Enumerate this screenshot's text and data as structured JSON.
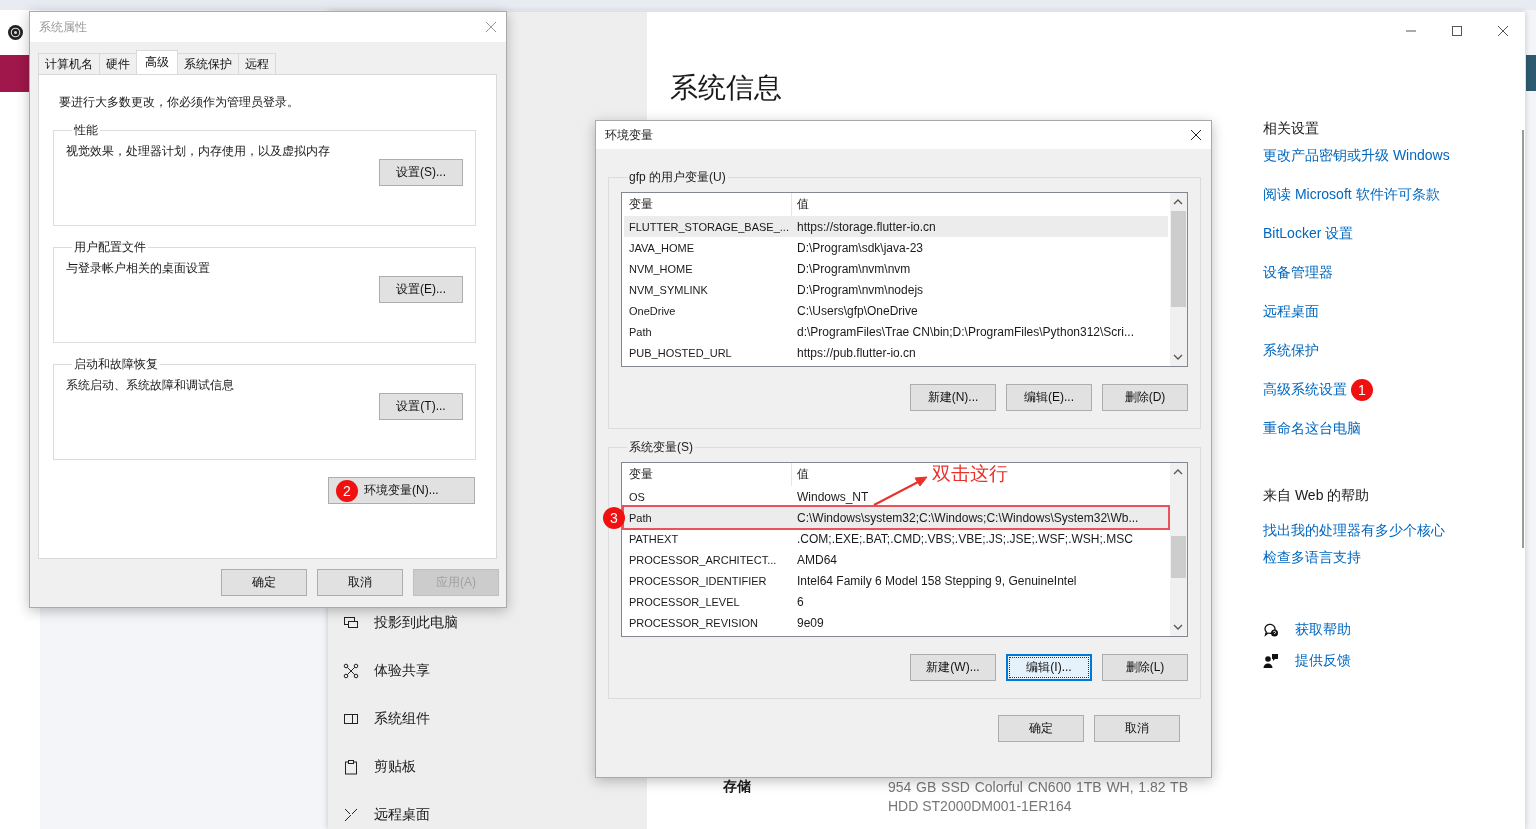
{
  "settings_window": {
    "heading": "系统信息",
    "nav_items": [
      {
        "label": "投影到此电脑"
      },
      {
        "label": "体验共享"
      },
      {
        "label": "系统组件"
      },
      {
        "label": "剪贴板"
      },
      {
        "label": "远程桌面"
      }
    ],
    "storage": {
      "label": "存储",
      "value": "954 GB SSD Colorful CN600 1TB WH, 1.82 TB HDD ST2000DM001-1ER164"
    },
    "related": {
      "title": "相关设置",
      "links": [
        {
          "label": "更改产品密钥或升级 Windows"
        },
        {
          "label": "阅读 Microsoft 软件许可条款"
        },
        {
          "label": "BitLocker 设置"
        },
        {
          "label": "设备管理器"
        },
        {
          "label": "远程桌面"
        },
        {
          "label": "系统保护"
        },
        {
          "label": "高级系统设置",
          "badge": "1"
        },
        {
          "label": "重命名这台电脑"
        }
      ]
    },
    "web_help": {
      "title": "来自 Web 的帮助",
      "links": [
        {
          "label": "找出我的处理器有多少个核心"
        },
        {
          "label": "检查多语言支持"
        }
      ]
    },
    "support_links": [
      {
        "label": "获取帮助"
      },
      {
        "label": "提供反馈"
      }
    ]
  },
  "system_properties": {
    "title": "系统属性",
    "active": false,
    "tabs": [
      {
        "label": "计算机名",
        "selected": false
      },
      {
        "label": "硬件",
        "selected": false
      },
      {
        "label": "高级",
        "selected": true
      },
      {
        "label": "系统保护",
        "selected": false
      },
      {
        "label": "远程",
        "selected": false
      }
    ],
    "notice": "要进行大多数更改，你必须作为管理员登录。",
    "groups": [
      {
        "title": "性能",
        "description": "视觉效果，处理器计划，内存使用，以及虚拟内存",
        "button": "设置(S)..."
      },
      {
        "title": "用户配置文件",
        "description": "与登录帐户相关的桌面设置",
        "button": "设置(E)..."
      },
      {
        "title": "启动和故障恢复",
        "description": "系统启动、系统故障和调试信息",
        "button": "设置(T)..."
      }
    ],
    "env_button": {
      "label": "环境变量(N)...",
      "badge": "2"
    },
    "footer_buttons": [
      {
        "label": "确定",
        "disabled": false
      },
      {
        "label": "取消",
        "disabled": false
      },
      {
        "label": "应用(A)",
        "disabled": true
      }
    ]
  },
  "env_dialog": {
    "title": "环境变量",
    "active": true,
    "sections": [
      {
        "title": "gfp 的用户变量(U)",
        "columns": [
          "变量",
          "值"
        ],
        "rows": [
          {
            "name": "FLUTTER_STORAGE_BASE_...",
            "value": "https://storage.flutter-io.cn",
            "selected": true
          },
          {
            "name": "JAVA_HOME",
            "value": "D:\\Program\\sdk\\java-23",
            "selected": false
          },
          {
            "name": "NVM_HOME",
            "value": "D:\\Program\\nvm\\nvm",
            "selected": false
          },
          {
            "name": "NVM_SYMLINK",
            "value": "D:\\Program\\nvm\\nodejs",
            "selected": false
          },
          {
            "name": "OneDrive",
            "value": "C:\\Users\\gfp\\OneDrive",
            "selected": false
          },
          {
            "name": "Path",
            "value": "d:\\ProgramFiles\\Trae CN\\bin;D:\\ProgramFiles\\Python312\\Scri...",
            "selected": false
          },
          {
            "name": "PUB_HOSTED_URL",
            "value": "https://pub.flutter-io.cn",
            "selected": false
          }
        ],
        "buttons": [
          {
            "label": "新建(N)...",
            "focused": false
          },
          {
            "label": "编辑(E)...",
            "focused": false
          },
          {
            "label": "删除(D)",
            "focused": false
          }
        ]
      },
      {
        "title": "系统变量(S)",
        "columns": [
          "变量",
          "值"
        ],
        "rows": [
          {
            "name": "OS",
            "value": "Windows_NT",
            "selected": false
          },
          {
            "name": "Path",
            "value": "C:\\Windows\\system32;C:\\Windows;C:\\Windows\\System32\\Wb...",
            "selected": true,
            "highlighted": true,
            "badge": "3",
            "note": "双击这行"
          },
          {
            "name": "PATHEXT",
            "value": ".COM;.EXE;.BAT;.CMD;.VBS;.VBE;.JS;.JSE;.WSF;.WSH;.MSC",
            "selected": false
          },
          {
            "name": "PROCESSOR_ARCHITECT...",
            "value": "AMD64",
            "selected": false
          },
          {
            "name": "PROCESSOR_IDENTIFIER",
            "value": "Intel64 Family 6 Model 158 Stepping 9, GenuineIntel",
            "selected": false
          },
          {
            "name": "PROCESSOR_LEVEL",
            "value": "6",
            "selected": false
          },
          {
            "name": "PROCESSOR_REVISION",
            "value": "9e09",
            "selected": false
          }
        ],
        "buttons": [
          {
            "label": "新建(W)...",
            "focused": false
          },
          {
            "label": "编辑(I)...",
            "focused": true
          },
          {
            "label": "删除(L)",
            "focused": false
          }
        ]
      }
    ],
    "footer_buttons": [
      {
        "label": "确定"
      },
      {
        "label": "取消"
      }
    ]
  }
}
